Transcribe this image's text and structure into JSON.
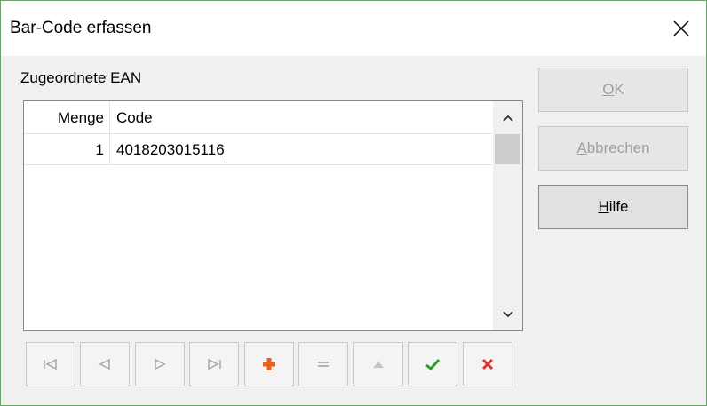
{
  "window": {
    "title": "Bar-Code erfassen"
  },
  "group": {
    "label_accel": "Z",
    "label_rest": "ugeordnete EAN"
  },
  "grid": {
    "columns": [
      "Menge",
      "Code"
    ],
    "rows": [
      {
        "menge": "1",
        "code": "4018203015116"
      }
    ]
  },
  "navigator": {
    "buttons": [
      {
        "name": "first-record-button",
        "icon": "first-icon",
        "enabled": false
      },
      {
        "name": "prior-record-button",
        "icon": "prior-icon",
        "enabled": false
      },
      {
        "name": "next-record-button",
        "icon": "next-icon",
        "enabled": false
      },
      {
        "name": "last-record-button",
        "icon": "last-icon",
        "enabled": false
      },
      {
        "name": "insert-record-button",
        "icon": "plus-icon",
        "enabled": true
      },
      {
        "name": "delete-record-button",
        "icon": "minus-icon",
        "enabled": false
      },
      {
        "name": "edit-record-button",
        "icon": "triangle-up-icon",
        "enabled": false
      },
      {
        "name": "post-record-button",
        "icon": "checkmark-icon",
        "enabled": true
      },
      {
        "name": "cancel-record-button",
        "icon": "cross-icon",
        "enabled": true
      }
    ]
  },
  "buttons": {
    "ok_accel": "O",
    "ok_rest": "K",
    "cancel_accel": "A",
    "cancel_rest": "bbrechen",
    "help_accel": "H",
    "help_rest": "ilfe"
  },
  "colors": {
    "plus": "#e8601c",
    "check": "#2e9b2e",
    "cross": "#d9322e",
    "disabled_icon": "#a8a8a8",
    "window_border": "#6aa06a"
  }
}
